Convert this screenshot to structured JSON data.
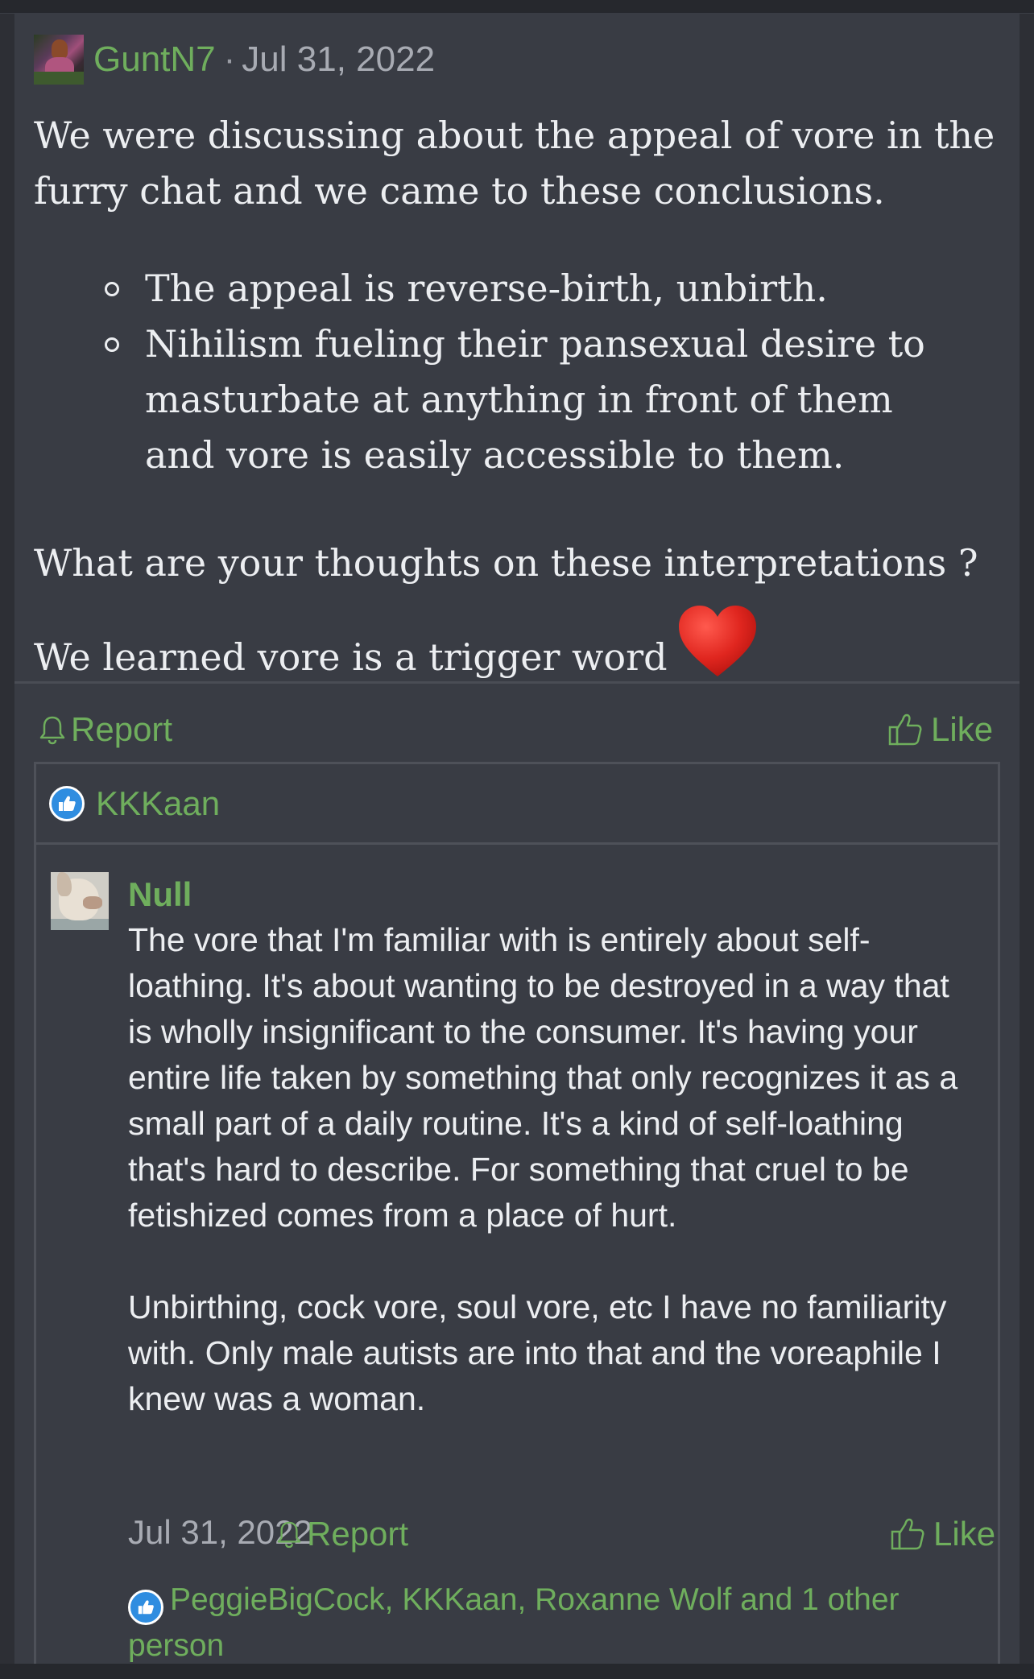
{
  "post": {
    "author": "GuntN7",
    "separator": "·",
    "date": "Jul 31, 2022",
    "intro": "We were discussing about the appeal of vore in the furry chat and we came to these conclusions.",
    "bullets": [
      "The appeal is reverse-birth, unbirth.",
      "Nihilism fueling their pansexual desire to masturbate at anything in front of them and vore is easily accessible to them."
    ],
    "closing": "What are your thoughts on these interpretations ? We learned vore is a trigger word",
    "report_label": "Report",
    "like_label": "Like"
  },
  "quote": {
    "liked_by": "KKKaan",
    "reply": {
      "author": "Null",
      "paragraphs": [
        "The vore that I'm familiar with is entirely about self-loathing. It's about wanting to be destroyed in a way that is wholly insignificant to the consumer. It's having your entire life taken by something that only recognizes it as a small part of a daily routine. It's a kind of self-loathing that's hard to describe. For something that cruel to be fetishized comes from a place of hurt.",
        "Unbirthing, cock vore, soul vore, etc I have no familiarity with. Only male autists are into that and the voreaphile I knew was a woman."
      ],
      "date": "Jul 31, 2022",
      "report_label": "Report",
      "like_label": "Like",
      "likers": "PeggieBigCock, KKKaan, Roxanne Wolf and 1 other person"
    }
  },
  "colors": {
    "accent_green": "#6fae5d",
    "background": "#2d2f35",
    "panel": "#393c44",
    "like_blue": "#2f8de0",
    "heart_red": "#e0261f"
  },
  "icons": {
    "avatar": "user-avatar",
    "report": "bell-icon",
    "like": "thumbs-up-icon",
    "heart": "heart-emoji-icon"
  }
}
